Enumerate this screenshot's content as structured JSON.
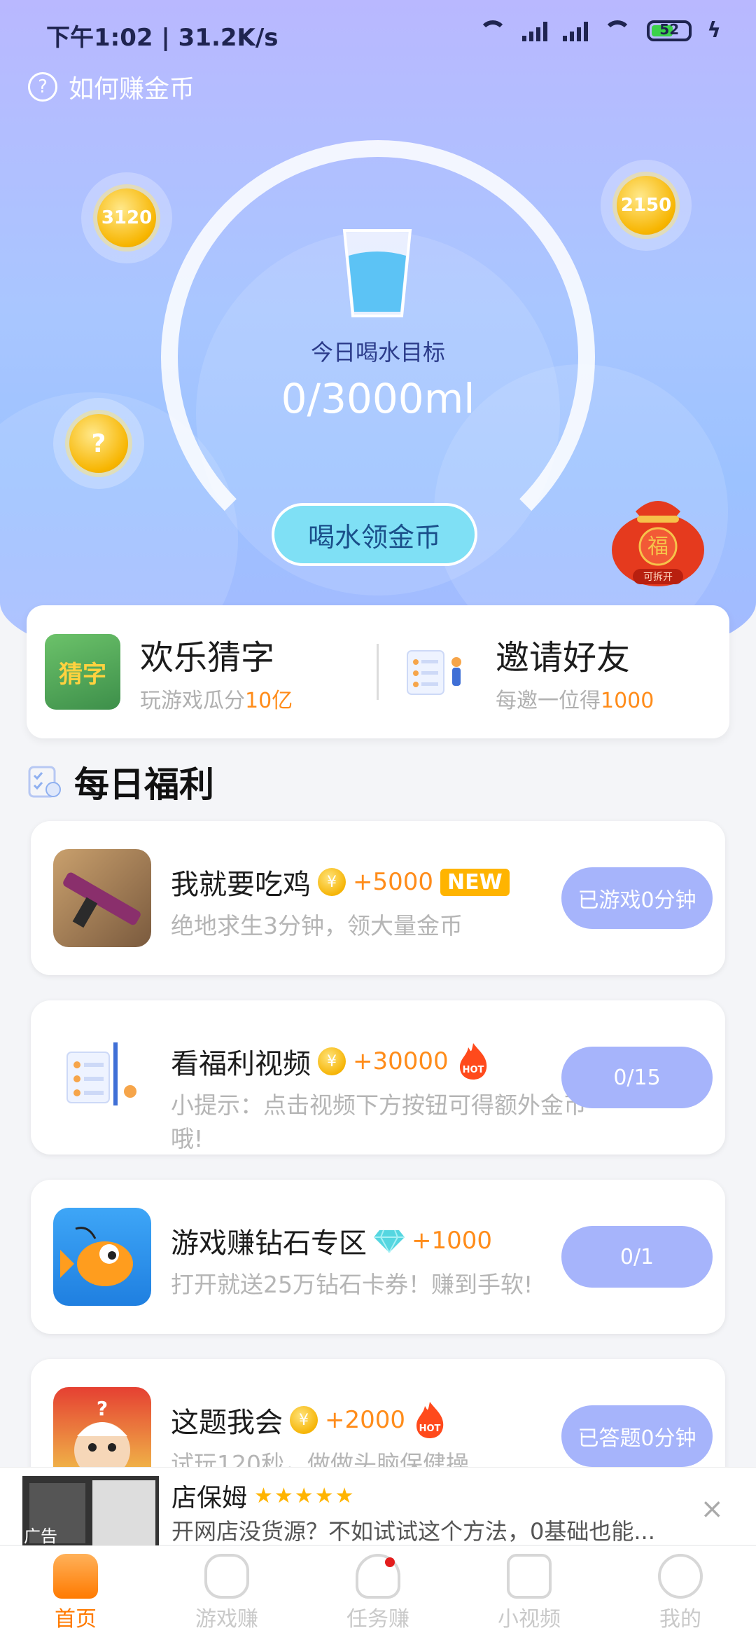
{
  "status": {
    "time": "下午1:02 | 31.2K/s",
    "battery": "52"
  },
  "header": {
    "howto_label": "如何赚金币"
  },
  "coins": {
    "left_top": "3120",
    "right_top": "2150",
    "left_mid": "?"
  },
  "water": {
    "goal_label": "今日喝水目标",
    "goal_value": "0/3000ml",
    "button": "喝水领金币"
  },
  "lucky_bag": {
    "char": "福",
    "label": "可拆开"
  },
  "promo": [
    {
      "title": "欢乐猜字",
      "sub_prefix": "玩游戏瓜分",
      "sub_highlight": "10亿",
      "sub_suffix": ""
    },
    {
      "title": "邀请好友",
      "sub_prefix": "每邀一位得",
      "sub_highlight": "1000",
      "sub_suffix": ""
    }
  ],
  "section": {
    "title": "每日福利"
  },
  "tasks": [
    {
      "name": "我就要吃鸡",
      "reward": "+5000",
      "tag": "NEW",
      "desc": "绝地求生3分钟，领大量金币",
      "button": "已游戏0分钟"
    },
    {
      "name": "看福利视频",
      "reward": "+30000",
      "tag": "HOT",
      "desc": "小提示：点击视频下方按钮可得额外金币哦!",
      "button": "0/15"
    },
    {
      "name": "游戏赚钻石专区",
      "reward": "+1000",
      "tag": "",
      "desc": "打开就送25万钻石卡券！赚到手软!",
      "button": "0/1"
    },
    {
      "name": "这题我会",
      "reward": "+2000",
      "tag": "HOT",
      "desc": "试玩120秒，做做头脑保健操",
      "button": "已答题0分钟"
    }
  ],
  "ad": {
    "name": "店保姆",
    "stars": "★★★★★",
    "text": "开网店没货源？不如试试这个方法，0基础也能...",
    "label": "广告",
    "close": "×"
  },
  "tabs": [
    {
      "label": "首页",
      "active": true
    },
    {
      "label": "游戏赚",
      "active": false
    },
    {
      "label": "任务赚",
      "active": false
    },
    {
      "label": "小视频",
      "active": false
    },
    {
      "label": "我的",
      "active": false
    }
  ],
  "colors": {
    "accent": "#ff8c1a",
    "button_blue": "#a6b4fb",
    "tab_active": "#ff7a00"
  }
}
